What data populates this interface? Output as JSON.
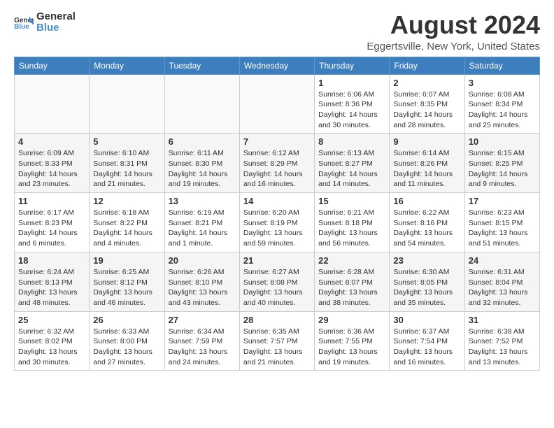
{
  "header": {
    "logo_general": "General",
    "logo_blue": "Blue",
    "month_year": "August 2024",
    "location": "Eggertsville, New York, United States"
  },
  "weekdays": [
    "Sunday",
    "Monday",
    "Tuesday",
    "Wednesday",
    "Thursday",
    "Friday",
    "Saturday"
  ],
  "weeks": [
    [
      {
        "day": "",
        "info": ""
      },
      {
        "day": "",
        "info": ""
      },
      {
        "day": "",
        "info": ""
      },
      {
        "day": "",
        "info": ""
      },
      {
        "day": "1",
        "info": "Sunrise: 6:06 AM\nSunset: 8:36 PM\nDaylight: 14 hours\nand 30 minutes."
      },
      {
        "day": "2",
        "info": "Sunrise: 6:07 AM\nSunset: 8:35 PM\nDaylight: 14 hours\nand 28 minutes."
      },
      {
        "day": "3",
        "info": "Sunrise: 6:08 AM\nSunset: 8:34 PM\nDaylight: 14 hours\nand 25 minutes."
      }
    ],
    [
      {
        "day": "4",
        "info": "Sunrise: 6:09 AM\nSunset: 8:33 PM\nDaylight: 14 hours\nand 23 minutes."
      },
      {
        "day": "5",
        "info": "Sunrise: 6:10 AM\nSunset: 8:31 PM\nDaylight: 14 hours\nand 21 minutes."
      },
      {
        "day": "6",
        "info": "Sunrise: 6:11 AM\nSunset: 8:30 PM\nDaylight: 14 hours\nand 19 minutes."
      },
      {
        "day": "7",
        "info": "Sunrise: 6:12 AM\nSunset: 8:29 PM\nDaylight: 14 hours\nand 16 minutes."
      },
      {
        "day": "8",
        "info": "Sunrise: 6:13 AM\nSunset: 8:27 PM\nDaylight: 14 hours\nand 14 minutes."
      },
      {
        "day": "9",
        "info": "Sunrise: 6:14 AM\nSunset: 8:26 PM\nDaylight: 14 hours\nand 11 minutes."
      },
      {
        "day": "10",
        "info": "Sunrise: 6:15 AM\nSunset: 8:25 PM\nDaylight: 14 hours\nand 9 minutes."
      }
    ],
    [
      {
        "day": "11",
        "info": "Sunrise: 6:17 AM\nSunset: 8:23 PM\nDaylight: 14 hours\nand 6 minutes."
      },
      {
        "day": "12",
        "info": "Sunrise: 6:18 AM\nSunset: 8:22 PM\nDaylight: 14 hours\nand 4 minutes."
      },
      {
        "day": "13",
        "info": "Sunrise: 6:19 AM\nSunset: 8:21 PM\nDaylight: 14 hours\nand 1 minute."
      },
      {
        "day": "14",
        "info": "Sunrise: 6:20 AM\nSunset: 8:19 PM\nDaylight: 13 hours\nand 59 minutes."
      },
      {
        "day": "15",
        "info": "Sunrise: 6:21 AM\nSunset: 8:18 PM\nDaylight: 13 hours\nand 56 minutes."
      },
      {
        "day": "16",
        "info": "Sunrise: 6:22 AM\nSunset: 8:16 PM\nDaylight: 13 hours\nand 54 minutes."
      },
      {
        "day": "17",
        "info": "Sunrise: 6:23 AM\nSunset: 8:15 PM\nDaylight: 13 hours\nand 51 minutes."
      }
    ],
    [
      {
        "day": "18",
        "info": "Sunrise: 6:24 AM\nSunset: 8:13 PM\nDaylight: 13 hours\nand 48 minutes."
      },
      {
        "day": "19",
        "info": "Sunrise: 6:25 AM\nSunset: 8:12 PM\nDaylight: 13 hours\nand 46 minutes."
      },
      {
        "day": "20",
        "info": "Sunrise: 6:26 AM\nSunset: 8:10 PM\nDaylight: 13 hours\nand 43 minutes."
      },
      {
        "day": "21",
        "info": "Sunrise: 6:27 AM\nSunset: 8:08 PM\nDaylight: 13 hours\nand 40 minutes."
      },
      {
        "day": "22",
        "info": "Sunrise: 6:28 AM\nSunset: 8:07 PM\nDaylight: 13 hours\nand 38 minutes."
      },
      {
        "day": "23",
        "info": "Sunrise: 6:30 AM\nSunset: 8:05 PM\nDaylight: 13 hours\nand 35 minutes."
      },
      {
        "day": "24",
        "info": "Sunrise: 6:31 AM\nSunset: 8:04 PM\nDaylight: 13 hours\nand 32 minutes."
      }
    ],
    [
      {
        "day": "25",
        "info": "Sunrise: 6:32 AM\nSunset: 8:02 PM\nDaylight: 13 hours\nand 30 minutes."
      },
      {
        "day": "26",
        "info": "Sunrise: 6:33 AM\nSunset: 8:00 PM\nDaylight: 13 hours\nand 27 minutes."
      },
      {
        "day": "27",
        "info": "Sunrise: 6:34 AM\nSunset: 7:59 PM\nDaylight: 13 hours\nand 24 minutes."
      },
      {
        "day": "28",
        "info": "Sunrise: 6:35 AM\nSunset: 7:57 PM\nDaylight: 13 hours\nand 21 minutes."
      },
      {
        "day": "29",
        "info": "Sunrise: 6:36 AM\nSunset: 7:55 PM\nDaylight: 13 hours\nand 19 minutes."
      },
      {
        "day": "30",
        "info": "Sunrise: 6:37 AM\nSunset: 7:54 PM\nDaylight: 13 hours\nand 16 minutes."
      },
      {
        "day": "31",
        "info": "Sunrise: 6:38 AM\nSunset: 7:52 PM\nDaylight: 13 hours\nand 13 minutes."
      }
    ]
  ]
}
